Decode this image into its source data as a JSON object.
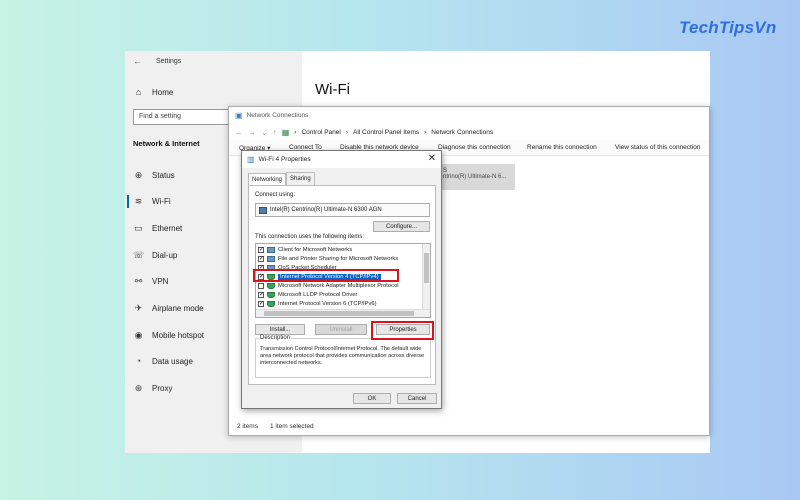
{
  "brand": "TechTipsVn",
  "settings": {
    "title": "Settings",
    "search_placeholder": "Find a setting",
    "section": "Network & Internet",
    "nav": [
      {
        "label": "Home",
        "icon": "home-icon"
      },
      {
        "label": "Status",
        "icon": "status-icon"
      },
      {
        "label": "Wi-Fi",
        "icon": "wifi-icon"
      },
      {
        "label": "Ethernet",
        "icon": "ethernet-icon"
      },
      {
        "label": "Dial-up",
        "icon": "dialup-icon"
      },
      {
        "label": "VPN",
        "icon": "vpn-icon"
      },
      {
        "label": "Airplane mode",
        "icon": "airplane-icon"
      },
      {
        "label": "Mobile hotspot",
        "icon": "hotspot-icon"
      },
      {
        "label": "Data usage",
        "icon": "data-usage-icon"
      },
      {
        "label": "Proxy",
        "icon": "proxy-icon"
      }
    ],
    "page_title": "Wi-Fi"
  },
  "netconn": {
    "title": "Network Connections",
    "breadcrumb": [
      "Control Panel",
      "All Control Panel Items",
      "Network Connections"
    ],
    "commands": [
      "Organize ▾",
      "Connect To",
      "Disable this network device",
      "Diagnose this connection",
      "Rename this connection",
      "View status of this connection"
    ],
    "tile_line1": "S",
    "tile_line2": "ntrino(R) Ultimate-N 6...",
    "status_items": "2 items",
    "status_selected": "1 item selected"
  },
  "dialog": {
    "title": "Wi-Fi 4 Properties",
    "tabs": [
      "Networking",
      "Sharing"
    ],
    "connect_using_label": "Connect using:",
    "adapter": "Intel(R) Centrino(R) Ultimate-N 6300 AGN",
    "configure": "Configure...",
    "items_label": "This connection uses the following items:",
    "items": [
      {
        "label": "Client for Microsoft Networks",
        "checked": "✓"
      },
      {
        "label": "File and Printer Sharing for Microsoft Networks",
        "checked": "✓"
      },
      {
        "label": "QoS Packet Scheduler",
        "checked": "✓"
      },
      {
        "label": "Internet Protocol Version 4 (TCP/IPv4)",
        "checked": "✓"
      },
      {
        "label": "Microsoft Network Adapter Multiplexor Protocol",
        "checked": ""
      },
      {
        "label": "Microsoft LLDP Protocol Driver",
        "checked": "✓"
      },
      {
        "label": "Internet Protocol Version 6 (TCP/IPv6)",
        "checked": "✓"
      }
    ],
    "install": "Install...",
    "uninstall": "Uninstall",
    "properties": "Properties",
    "description_title": "Description",
    "description": "Transmission Control Protocol/Internet Protocol. The default wide area network protocol that provides communication across diverse interconnected networks.",
    "ok": "OK",
    "cancel": "Cancel"
  },
  "colors": {
    "highlight": "#d9141b",
    "accent": "#0a61c9",
    "brand": "#2f6fe0"
  }
}
